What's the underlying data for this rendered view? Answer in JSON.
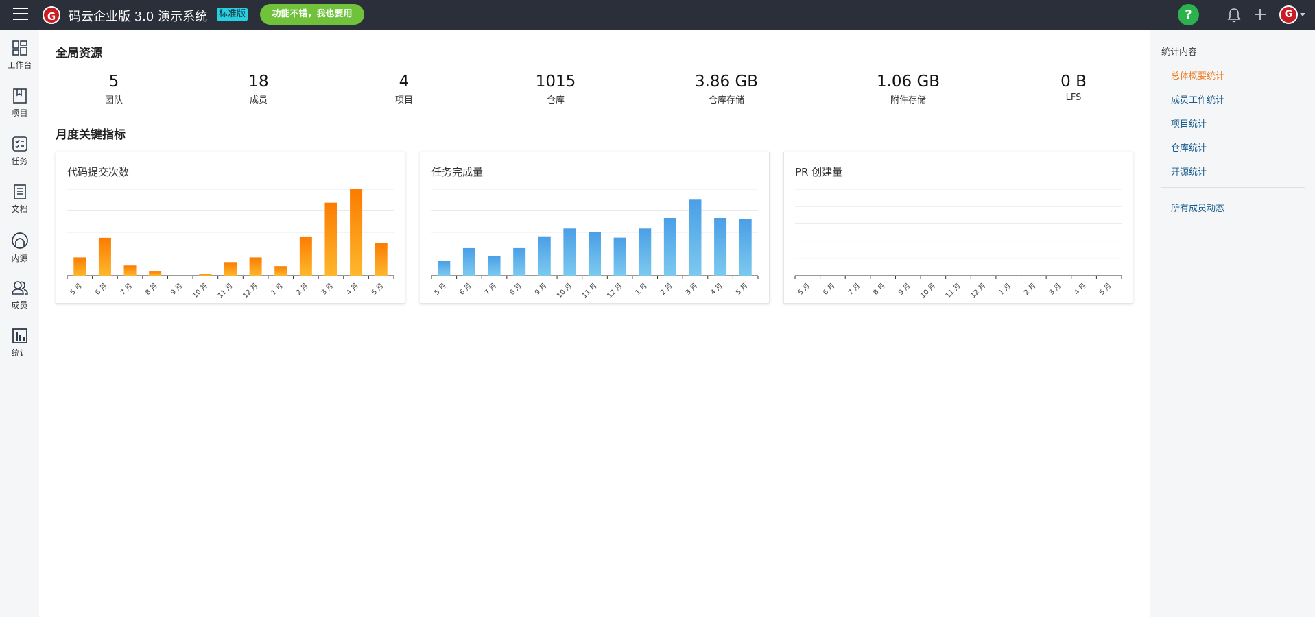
{
  "header": {
    "logo_letter": "G",
    "title": "码云企业版 3.0 演示系统",
    "edition_badge": "标准版",
    "promo_button": "功能不错，我也要用",
    "help_symbol": "?",
    "avatar_letter": "G"
  },
  "sidebar": {
    "items": [
      {
        "label": "工作台",
        "icon": "dashboard-icon"
      },
      {
        "label": "项目",
        "icon": "book-icon"
      },
      {
        "label": "任务",
        "icon": "task-icon"
      },
      {
        "label": "文档",
        "icon": "document-icon"
      },
      {
        "label": "内源",
        "icon": "innersource-icon"
      },
      {
        "label": "成员",
        "icon": "members-icon"
      },
      {
        "label": "统计",
        "icon": "statistics-icon"
      }
    ]
  },
  "main": {
    "global_title": "全局资源",
    "stats": [
      {
        "value": "5",
        "label": "团队"
      },
      {
        "value": "18",
        "label": "成员"
      },
      {
        "value": "4",
        "label": "项目"
      },
      {
        "value": "1015",
        "label": "仓库"
      },
      {
        "value": "3.86 GB",
        "label": "仓库存储"
      },
      {
        "value": "1.06 GB",
        "label": "附件存储"
      },
      {
        "value": "0 B",
        "label": "LFS"
      }
    ],
    "monthly_title": "月度关键指标"
  },
  "right_panel": {
    "title": "统计内容",
    "links": [
      {
        "label": "总体概要统计",
        "active": true
      },
      {
        "label": "成员工作统计",
        "active": false
      },
      {
        "label": "项目统计",
        "active": false
      },
      {
        "label": "仓库统计",
        "active": false
      },
      {
        "label": "开源统计",
        "active": false
      }
    ],
    "bottom_link": "所有成员动态"
  },
  "colors": {
    "topbar": "#2b2f3a",
    "accent_orange": "#f07b1e",
    "link_blue": "#1a5d8c",
    "bar_orange_top": "#fb7c00",
    "bar_orange_bottom": "#fdb72e",
    "bar_blue_top": "#4a9fe6",
    "bar_blue_bottom": "#7cc9ef"
  },
  "chart_data": [
    {
      "type": "bar",
      "title": "代码提交次数",
      "categories": [
        "5 月",
        "6 月",
        "7 月",
        "8 月",
        "9 月",
        "10 月",
        "11 月",
        "12 月",
        "1 月",
        "2 月",
        "3 月",
        "4 月",
        "5 月"
      ],
      "values": [
        27,
        56,
        15,
        6,
        0,
        3,
        20,
        27,
        14,
        58,
        108,
        128,
        48
      ],
      "ylim": [
        0,
        128
      ],
      "grid": true,
      "color": "orange"
    },
    {
      "type": "bar",
      "title": "任务完成量",
      "categories": [
        "5 月",
        "6 月",
        "7 月",
        "8 月",
        "9 月",
        "10 月",
        "11 月",
        "12 月",
        "1 月",
        "2 月",
        "3 月",
        "4 月",
        "5 月"
      ],
      "values": [
        11,
        21,
        15,
        21,
        30,
        36,
        33,
        29,
        36,
        44,
        58,
        44,
        43
      ],
      "ylim": [
        0,
        66
      ],
      "grid": true,
      "color": "blue"
    },
    {
      "type": "bar",
      "title": "PR 创建量",
      "categories": [
        "5 月",
        "6 月",
        "7 月",
        "8 月",
        "9 月",
        "10 月",
        "11 月",
        "12 月",
        "1 月",
        "2 月",
        "3 月",
        "4 月",
        "5 月"
      ],
      "values": [
        0,
        0,
        0,
        0,
        0,
        0,
        0,
        0,
        0,
        0,
        0,
        0,
        0
      ],
      "ylim": [
        0,
        5
      ],
      "grid": true,
      "color": "none"
    }
  ]
}
